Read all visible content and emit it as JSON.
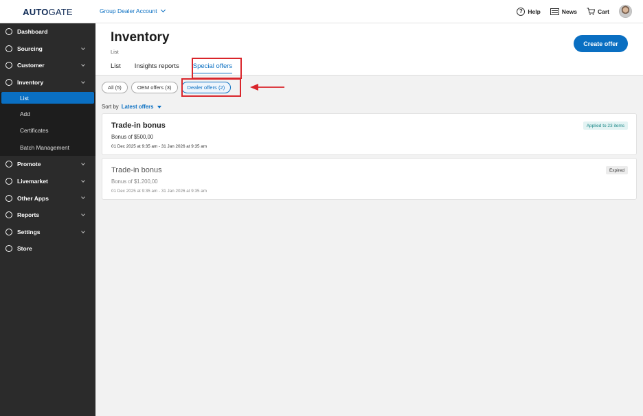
{
  "brand": {
    "logo_bold": "AUTO",
    "logo_light": "GATE"
  },
  "topbar": {
    "account": "Group Dealer Account",
    "help": "Help",
    "news": "News",
    "cart": "Cart"
  },
  "sidebar": {
    "items": [
      {
        "label": "Dashboard",
        "icon": "dashboard-icon"
      },
      {
        "label": "Sourcing",
        "icon": "sourcing-icon"
      },
      {
        "label": "Customer",
        "icon": "customer-icon"
      },
      {
        "label": "Inventory",
        "icon": "inventory-icon"
      }
    ],
    "sub_items": [
      "List",
      "Add",
      "Certificates",
      "Batch Management"
    ],
    "items_after": [
      {
        "label": "Promote",
        "icon": "promote-icon"
      },
      {
        "label": "Livemarket",
        "icon": "livemarket-icon"
      },
      {
        "label": "Other Apps",
        "icon": "apps-icon"
      },
      {
        "label": "Reports",
        "icon": "reports-icon"
      },
      {
        "label": "Settings",
        "icon": "settings-icon"
      },
      {
        "label": "Store",
        "icon": "store-icon"
      }
    ]
  },
  "page": {
    "title": "Inventory",
    "subtitle": "List",
    "create_button": "Create offer",
    "tabs": [
      "List",
      "Insights reports",
      "Special offers"
    ]
  },
  "filters": [
    "All (5)",
    "OEM offers (3)",
    "Dealer offers (2)"
  ],
  "sort": {
    "label": "Sort by",
    "value": "Latest offers"
  },
  "offers": [
    {
      "title": "Trade-in bonus",
      "amount": "Bonus of $500,00",
      "dates": "01 Dec 2025 at 9:35 am - 31 Jan 2026 at 9:35 am",
      "badge": "Applied to 23 items"
    },
    {
      "title": "Trade-in bonus",
      "amount": "Bonus of $1.200,00",
      "dates": "01 Dec 2025 at 9:35 am - 31 Jan 2026 at 9:35 am",
      "badge": "Expired"
    }
  ],
  "colors": {
    "accent": "#0a6fc2",
    "highlight": "#d9252b",
    "sidebar": "#2b2b2b"
  }
}
